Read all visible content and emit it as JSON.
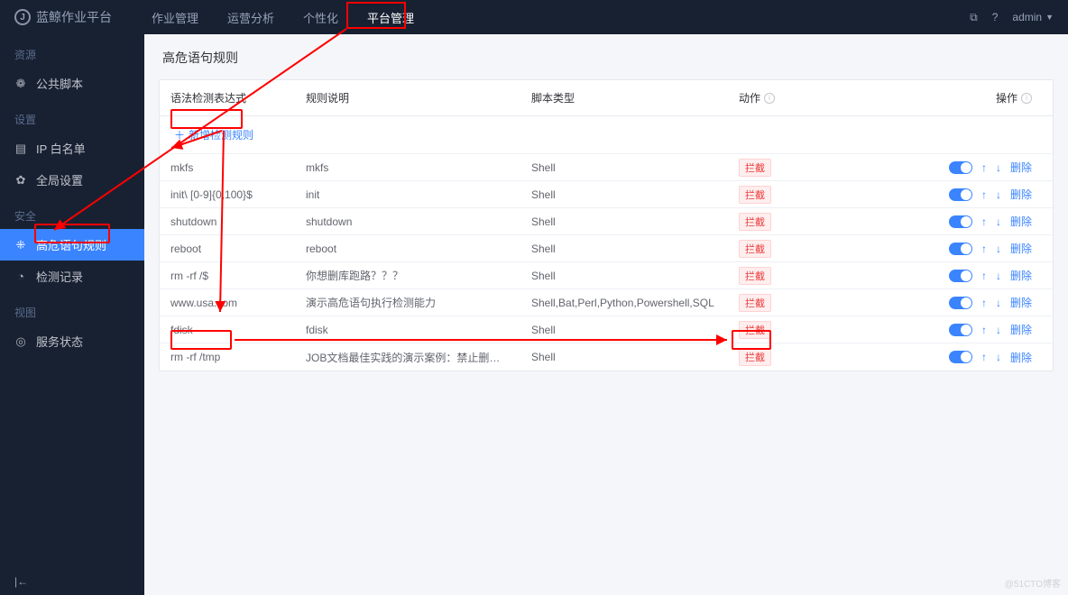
{
  "brand": "蓝鲸作业平台",
  "nav": {
    "items": [
      "作业管理",
      "运营分析",
      "个性化",
      "平台管理"
    ],
    "activeIndex": 3
  },
  "topbarRight": {
    "user": "admin"
  },
  "sidebar": {
    "sections": [
      {
        "title": "资源",
        "items": [
          {
            "icon": "gear-icon",
            "label": "公共脚本"
          }
        ]
      },
      {
        "title": "设置",
        "items": [
          {
            "icon": "list-icon",
            "label": "IP 白名单"
          },
          {
            "icon": "cog-icon",
            "label": "全局设置"
          }
        ]
      },
      {
        "title": "安全",
        "items": [
          {
            "icon": "bug-icon",
            "label": "高危语句规则",
            "active": true
          },
          {
            "icon": "clock-icon",
            "label": "检测记录"
          }
        ]
      },
      {
        "title": "视图",
        "items": [
          {
            "icon": "target-icon",
            "label": "服务状态"
          }
        ]
      }
    ]
  },
  "page": {
    "title": "高危语句规则"
  },
  "table": {
    "columns": [
      "语法检测表达式",
      "规则说明",
      "脚本类型",
      "动作",
      "操作"
    ],
    "addLabel": "新增检测规则",
    "deleteLabel": "删除",
    "rows": [
      {
        "expr": "mkfs",
        "desc": "mkfs",
        "type": "Shell",
        "action": "拦截"
      },
      {
        "expr": "init\\ [0-9]{0,100}$",
        "desc": "init",
        "type": "Shell",
        "action": "拦截"
      },
      {
        "expr": "shutdown",
        "desc": "shutdown",
        "type": "Shell",
        "action": "拦截"
      },
      {
        "expr": "reboot",
        "desc": "reboot",
        "type": "Shell",
        "action": "拦截"
      },
      {
        "expr": "rm -rf /$",
        "desc": "你想删库跑路？？？",
        "type": "Shell",
        "action": "拦截"
      },
      {
        "expr": "www.usa.com",
        "desc": "演示高危语句执行检测能力",
        "type": "Shell,Bat,Perl,Python,Powershell,SQL",
        "action": "拦截"
      },
      {
        "expr": "fdisk",
        "desc": "fdisk",
        "type": "Shell",
        "action": "拦截"
      },
      {
        "expr": "rm -rf /tmp",
        "desc": "JOB文档最佳实践的演示案例：禁止删除临时缓存目...",
        "type": "Shell",
        "action": "拦截"
      }
    ]
  },
  "watermark": "@51CTO博客"
}
